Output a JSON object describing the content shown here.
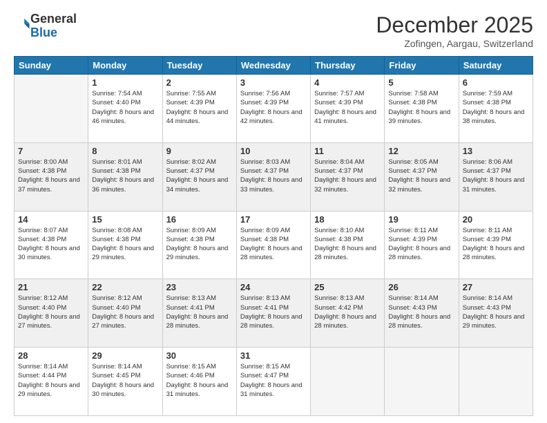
{
  "logo": {
    "general": "General",
    "blue": "Blue"
  },
  "header": {
    "month": "December 2025",
    "location": "Zofingen, Aargau, Switzerland"
  },
  "days_of_week": [
    "Sunday",
    "Monday",
    "Tuesday",
    "Wednesday",
    "Thursday",
    "Friday",
    "Saturday"
  ],
  "weeks": [
    [
      {
        "day": "",
        "empty": true
      },
      {
        "day": "1",
        "sunrise": "7:54 AM",
        "sunset": "4:40 PM",
        "daylight": "8 hours and 46 minutes."
      },
      {
        "day": "2",
        "sunrise": "7:55 AM",
        "sunset": "4:39 PM",
        "daylight": "8 hours and 44 minutes."
      },
      {
        "day": "3",
        "sunrise": "7:56 AM",
        "sunset": "4:39 PM",
        "daylight": "8 hours and 42 minutes."
      },
      {
        "day": "4",
        "sunrise": "7:57 AM",
        "sunset": "4:39 PM",
        "daylight": "8 hours and 41 minutes."
      },
      {
        "day": "5",
        "sunrise": "7:58 AM",
        "sunset": "4:38 PM",
        "daylight": "8 hours and 39 minutes."
      },
      {
        "day": "6",
        "sunrise": "7:59 AM",
        "sunset": "4:38 PM",
        "daylight": "8 hours and 38 minutes."
      }
    ],
    [
      {
        "day": "7",
        "sunrise": "8:00 AM",
        "sunset": "4:38 PM",
        "daylight": "8 hours and 37 minutes."
      },
      {
        "day": "8",
        "sunrise": "8:01 AM",
        "sunset": "4:38 PM",
        "daylight": "8 hours and 36 minutes."
      },
      {
        "day": "9",
        "sunrise": "8:02 AM",
        "sunset": "4:37 PM",
        "daylight": "8 hours and 34 minutes."
      },
      {
        "day": "10",
        "sunrise": "8:03 AM",
        "sunset": "4:37 PM",
        "daylight": "8 hours and 33 minutes."
      },
      {
        "day": "11",
        "sunrise": "8:04 AM",
        "sunset": "4:37 PM",
        "daylight": "8 hours and 32 minutes."
      },
      {
        "day": "12",
        "sunrise": "8:05 AM",
        "sunset": "4:37 PM",
        "daylight": "8 hours and 32 minutes."
      },
      {
        "day": "13",
        "sunrise": "8:06 AM",
        "sunset": "4:37 PM",
        "daylight": "8 hours and 31 minutes."
      }
    ],
    [
      {
        "day": "14",
        "sunrise": "8:07 AM",
        "sunset": "4:38 PM",
        "daylight": "8 hours and 30 minutes."
      },
      {
        "day": "15",
        "sunrise": "8:08 AM",
        "sunset": "4:38 PM",
        "daylight": "8 hours and 29 minutes."
      },
      {
        "day": "16",
        "sunrise": "8:09 AM",
        "sunset": "4:38 PM",
        "daylight": "8 hours and 29 minutes."
      },
      {
        "day": "17",
        "sunrise": "8:09 AM",
        "sunset": "4:38 PM",
        "daylight": "8 hours and 28 minutes."
      },
      {
        "day": "18",
        "sunrise": "8:10 AM",
        "sunset": "4:38 PM",
        "daylight": "8 hours and 28 minutes."
      },
      {
        "day": "19",
        "sunrise": "8:11 AM",
        "sunset": "4:39 PM",
        "daylight": "8 hours and 28 minutes."
      },
      {
        "day": "20",
        "sunrise": "8:11 AM",
        "sunset": "4:39 PM",
        "daylight": "8 hours and 28 minutes."
      }
    ],
    [
      {
        "day": "21",
        "sunrise": "8:12 AM",
        "sunset": "4:40 PM",
        "daylight": "8 hours and 27 minutes."
      },
      {
        "day": "22",
        "sunrise": "8:12 AM",
        "sunset": "4:40 PM",
        "daylight": "8 hours and 27 minutes."
      },
      {
        "day": "23",
        "sunrise": "8:13 AM",
        "sunset": "4:41 PM",
        "daylight": "8 hours and 28 minutes."
      },
      {
        "day": "24",
        "sunrise": "8:13 AM",
        "sunset": "4:41 PM",
        "daylight": "8 hours and 28 minutes."
      },
      {
        "day": "25",
        "sunrise": "8:13 AM",
        "sunset": "4:42 PM",
        "daylight": "8 hours and 28 minutes."
      },
      {
        "day": "26",
        "sunrise": "8:14 AM",
        "sunset": "4:43 PM",
        "daylight": "8 hours and 28 minutes."
      },
      {
        "day": "27",
        "sunrise": "8:14 AM",
        "sunset": "4:43 PM",
        "daylight": "8 hours and 29 minutes."
      }
    ],
    [
      {
        "day": "28",
        "sunrise": "8:14 AM",
        "sunset": "4:44 PM",
        "daylight": "8 hours and 29 minutes."
      },
      {
        "day": "29",
        "sunrise": "8:14 AM",
        "sunset": "4:45 PM",
        "daylight": "8 hours and 30 minutes."
      },
      {
        "day": "30",
        "sunrise": "8:15 AM",
        "sunset": "4:46 PM",
        "daylight": "8 hours and 31 minutes."
      },
      {
        "day": "31",
        "sunrise": "8:15 AM",
        "sunset": "4:47 PM",
        "daylight": "8 hours and 31 minutes."
      },
      {
        "day": "",
        "empty": true
      },
      {
        "day": "",
        "empty": true
      },
      {
        "day": "",
        "empty": true
      }
    ]
  ],
  "labels": {
    "sunrise": "Sunrise:",
    "sunset": "Sunset:",
    "daylight": "Daylight:"
  }
}
